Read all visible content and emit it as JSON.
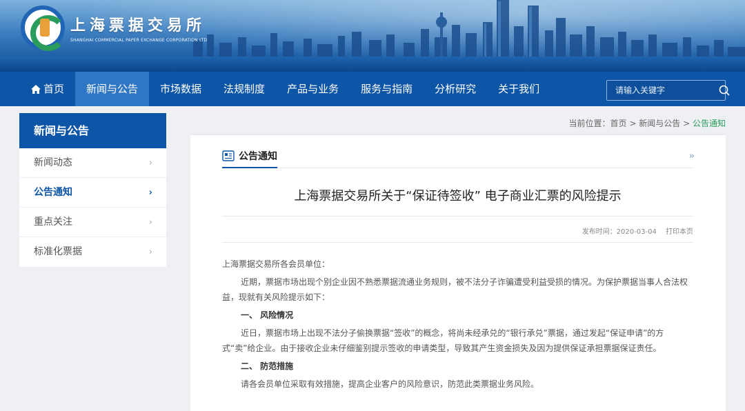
{
  "header": {
    "logo_cn": "上海票据交易所",
    "logo_en": "SHANGHAI COMMERCIAL PAPER EXCHANGE CORPORATION LTD"
  },
  "nav": {
    "items": [
      {
        "label": "首页",
        "icon": "home-icon"
      },
      {
        "label": "新闻与公告",
        "active": true
      },
      {
        "label": "市场数据"
      },
      {
        "label": "法规制度"
      },
      {
        "label": "产品与业务"
      },
      {
        "label": "服务与指南"
      },
      {
        "label": "分析研究"
      },
      {
        "label": "关于我们"
      }
    ],
    "search_placeholder": "请输入关键字",
    "search_icon": "search-icon"
  },
  "sidebar": {
    "title": "新闻与公告",
    "items": [
      {
        "label": "新闻动态"
      },
      {
        "label": "公告通知",
        "active": true
      },
      {
        "label": "重点关注"
      },
      {
        "label": "标准化票据"
      }
    ],
    "chevron": "›"
  },
  "breadcrumb": {
    "prefix": "当前位置：",
    "items": [
      "首页",
      "新闻与公告",
      "公告通知"
    ],
    "separator": ">"
  },
  "section": {
    "title": "公告通知",
    "icon": "notice-icon",
    "more": "››"
  },
  "article": {
    "title": "上海票据交易所关于“保证待签收” 电子商业汇票的风险提示",
    "publish_label": "发布时间：2020-03-04",
    "print_label": "打印本页",
    "paragraphs": [
      {
        "type": "plain",
        "text": "上海票据交易所各会员单位："
      },
      {
        "type": "indent",
        "text": "近期，票据市场出现个别企业因不熟悉票据流通业务规则，被不法分子诈骗遭受利益受损的情况。为保护票据当事人合法权益，现就有关风险提示如下："
      },
      {
        "type": "heading",
        "text": "一、 风险情况"
      },
      {
        "type": "indent",
        "text": "近日，票据市场上出现不法分子偷换票据“签收”的概念，将尚未经承兑的“银行承兑”票据，通过发起“保证申请”的方式“卖”给企业。由于接收企业未仔细鉴别提示签收的申请类型，导致其产生资金损失及因为提供保证承担票据保证责任。"
      },
      {
        "type": "heading",
        "text": "二、 防范措施"
      },
      {
        "type": "indent",
        "text": "请各会员单位采取有效措施，提高企业客户的风险意识，防范此类票据业务风险。"
      }
    ]
  },
  "colors": {
    "nav_bg": "#0d55a6",
    "nav_active": "#2f76c4",
    "accent_green": "#2a9d5c",
    "page_bg": "#eef0f3"
  }
}
